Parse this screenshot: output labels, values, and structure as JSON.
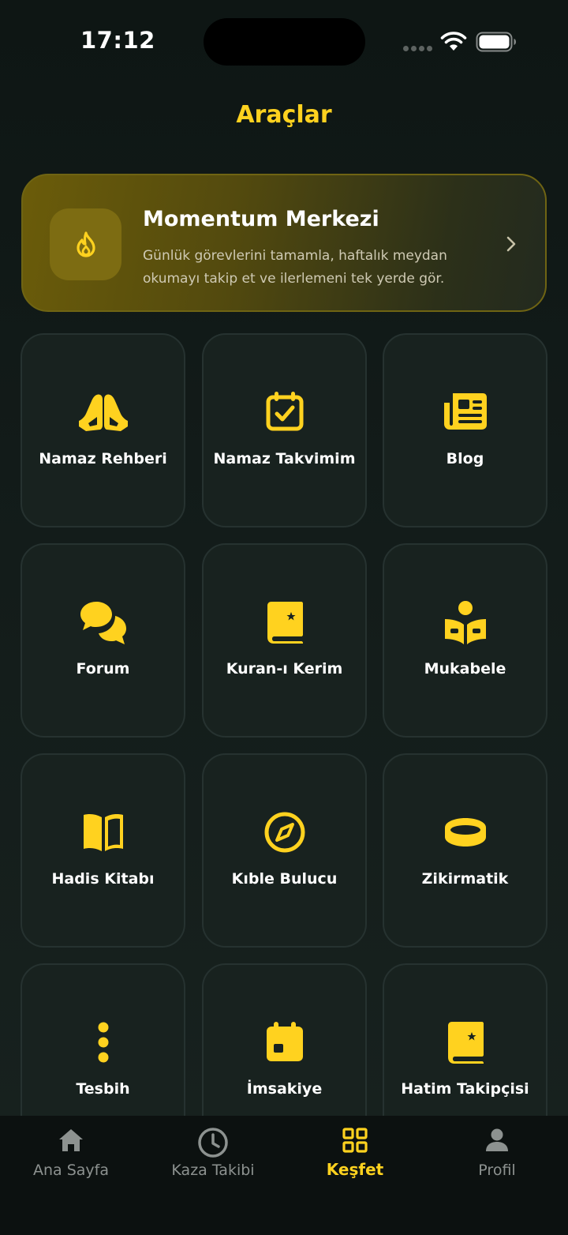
{
  "status_bar": {
    "time": "17:12"
  },
  "header": {
    "title": "Araçlar"
  },
  "momentum": {
    "title": "Momentum Merkezi",
    "description": "Günlük görevlerini tamamla, haftalık meydan okumayı takip et ve ilerlemeni tek yerde gör.",
    "icon": "flame-icon"
  },
  "tools": [
    {
      "label": "Namaz Rehberi",
      "icon": "praying-hands-icon"
    },
    {
      "label": "Namaz Takvimim",
      "icon": "calendar-check-icon"
    },
    {
      "label": "Blog",
      "icon": "newspaper-icon"
    },
    {
      "label": "Forum",
      "icon": "chat-bubbles-icon"
    },
    {
      "label": "Kuran-ı Kerim",
      "icon": "quran-book-icon"
    },
    {
      "label": "Mukabele",
      "icon": "reader-icon"
    },
    {
      "label": "Hadis Kitabı",
      "icon": "open-book-icon"
    },
    {
      "label": "Kıble Bulucu",
      "icon": "compass-icon"
    },
    {
      "label": "Zikirmatik",
      "icon": "ring-counter-icon"
    },
    {
      "label": "Tesbih",
      "icon": "beads-icon"
    },
    {
      "label": "İmsakiye",
      "icon": "calendar-icon"
    },
    {
      "label": "Hatim Takipçisi",
      "icon": "quran-book-icon"
    }
  ],
  "bottom_nav": [
    {
      "label": "Ana Sayfa",
      "icon": "home-icon",
      "active": false
    },
    {
      "label": "Kaza Takibi",
      "icon": "clock-icon",
      "active": false
    },
    {
      "label": "Keşfet",
      "icon": "grid-icon",
      "active": true
    },
    {
      "label": "Profil",
      "icon": "person-icon",
      "active": false
    }
  ],
  "colors": {
    "accent": "#ffd21f",
    "background": "#131c1a",
    "tile": "#18221f",
    "inactive": "#8d9290"
  }
}
